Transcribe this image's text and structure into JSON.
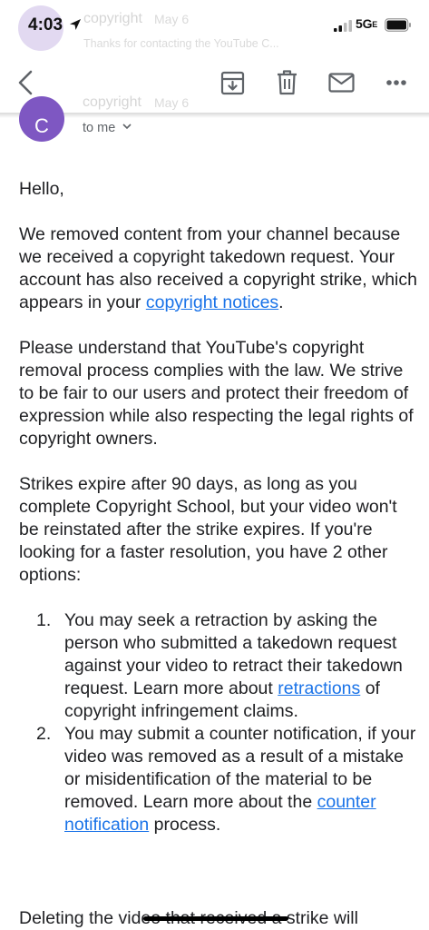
{
  "status_bar": {
    "time": "4:03",
    "network_main": "5G",
    "network_sub": "E"
  },
  "background_notification": {
    "sender": "copyright",
    "date": "May 6",
    "snippet": "Thanks for contacting the YouTube C..."
  },
  "toolbar": {
    "back_icon": "chevron-left-icon",
    "archive_icon": "archive-icon",
    "delete_icon": "trash-icon",
    "mail_icon": "envelope-icon",
    "more_icon": "more-horizontal-icon"
  },
  "message": {
    "avatar_letter": "C",
    "avatar_color": "#7e57c2",
    "sender_ghost": "copyright",
    "date_ghost": "May 6",
    "recipient": "to me",
    "greeting": "Hello,",
    "para1_text": "We removed content from your channel because we received a copyright takedown request. Your account has also received a copyright strike, which appears in your ",
    "para1_link": "copyright notices",
    "para1_end": ".",
    "para2": "Please understand that YouTube's copyright removal process complies with the law. We strive to be fair to our users and protect their freedom of expression while also respecting the legal rights of copyright owners.",
    "para3": "Strikes expire after 90 days, as long as you complete Copyright School, but your video won't be reinstated after the strike expires. If you're looking for a faster resolution, you have 2 other options:",
    "options": [
      {
        "num": "1.",
        "text_before": "You may seek a retraction by asking the person who submitted a takedown request against your video to retract their takedown request. Learn more about ",
        "link": "retractions",
        "text_after": " of copyright infringement claims."
      },
      {
        "num": "2.",
        "text_before": "You may submit a counter notification, if your video was removed as a result of a mistake or misidentification of the material to be removed. Learn more about the ",
        "link": "counter notification",
        "text_after": " process."
      }
    ],
    "cut_line": "Deleting the video that received a strike will"
  },
  "colors": {
    "link": "#1a73e8",
    "text": "#202124",
    "icon": "#5f6368"
  }
}
